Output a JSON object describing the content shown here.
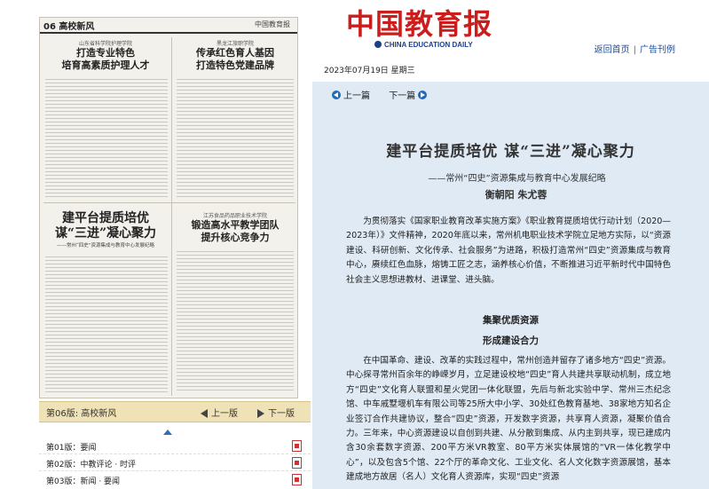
{
  "left": {
    "paper": {
      "page_no": "06",
      "section": "高校新风",
      "masthead": "中国教育报",
      "articles": [
        {
          "kicker": "山东省科学院护理学院",
          "headline": "打造专业特色\n培育高素质护理人才"
        },
        {
          "kicker": "黑龙江旅职学院",
          "headline": "传承红色育人基因\n打造特色党建品牌"
        },
        {
          "kicker": "",
          "headline": "建平台提质培优\n谋“三进”凝心聚力",
          "sub": "——常州“四史”资源集成与教育中心发展纪略"
        },
        {
          "kicker": "江苏食品药品职业技术学院",
          "headline": "锻造高水平教学团队\n提升核心竞争力"
        }
      ]
    },
    "page_bar": {
      "current": "第06版: 高校新风",
      "prev": "上一版",
      "next": "下一版"
    },
    "page_list": [
      {
        "label": "第01版：要闻"
      },
      {
        "label": "第02版：中教评论 · 时评"
      },
      {
        "label": "第03版：新闻 · 要闻"
      }
    ]
  },
  "header": {
    "logo": "中国教育报",
    "logo_en": "CHINA EDUCATION DAILY",
    "nav": [
      "返回首页",
      "广告刊例"
    ],
    "date": "2023年07月19日 星期三"
  },
  "article": {
    "nav": {
      "prev": "上一篇",
      "next": "下一篇"
    },
    "title": "建平台提质培优 谋“三进”凝心聚力",
    "subtitle": "——常州“四史”资源集成与教育中心发展纪略",
    "author": "衡朝阳 朱尤蓉",
    "intro": "为贯彻落实《国家职业教育改革实施方案》《职业教育提质培优行动计划（2020—2023年）》文件精神，2020年底以来，常州机电职业技术学院立足地方实际，以“资源建设、科研创新、文化传承、社会服务”为进路，积极打造常州“四史”资源集成与教育中心，赓续红色血脉，熔铸工匠之志，涵养核心价值，不断推进习近平新时代中国特色社会主义思想进教材、进课堂、进头脑。",
    "section1": "集聚优质资源",
    "section2": "形成建设合力",
    "body": "在中国革命、建设、改革的实践过程中，常州创造并留存了诸多地方“四史”资源。中心探寻常州百余年的峥嵘岁月，立足建设校地“四史”育人共建共享联动机制，成立地方“四史”文化育人联盟和星火党团一体化联盟，先后与新北实验中学、常州三杰纪念馆、中车戚墅堰机车有限公司等25所大中小学、30处红色教育基地、38家地方知名企业签订合作共建协议，整合“四史”资源，开发数字资源，共享育人资源，凝聚价值合力。三年来，中心资源建设以自创到共建、从分散到集成、从内主到共享，现已建成内含30余套数字资源、200平方米VR教室、80平方米实体展馆的“VR一体化教学中心”，以及包含5个馆、22个厅的革命文化、工业文化、名人文化数字资源展馆，基本建成地方故居（名人）文化育人资源库，实现“四史”资源"
  },
  "colors": {
    "brand_red": "#cc1d1d",
    "brand_blue": "#1d3f86",
    "link_blue": "#1b4e9d",
    "article_bg": "#dfeaf5",
    "page_bar_bg": "#efe2b6"
  }
}
